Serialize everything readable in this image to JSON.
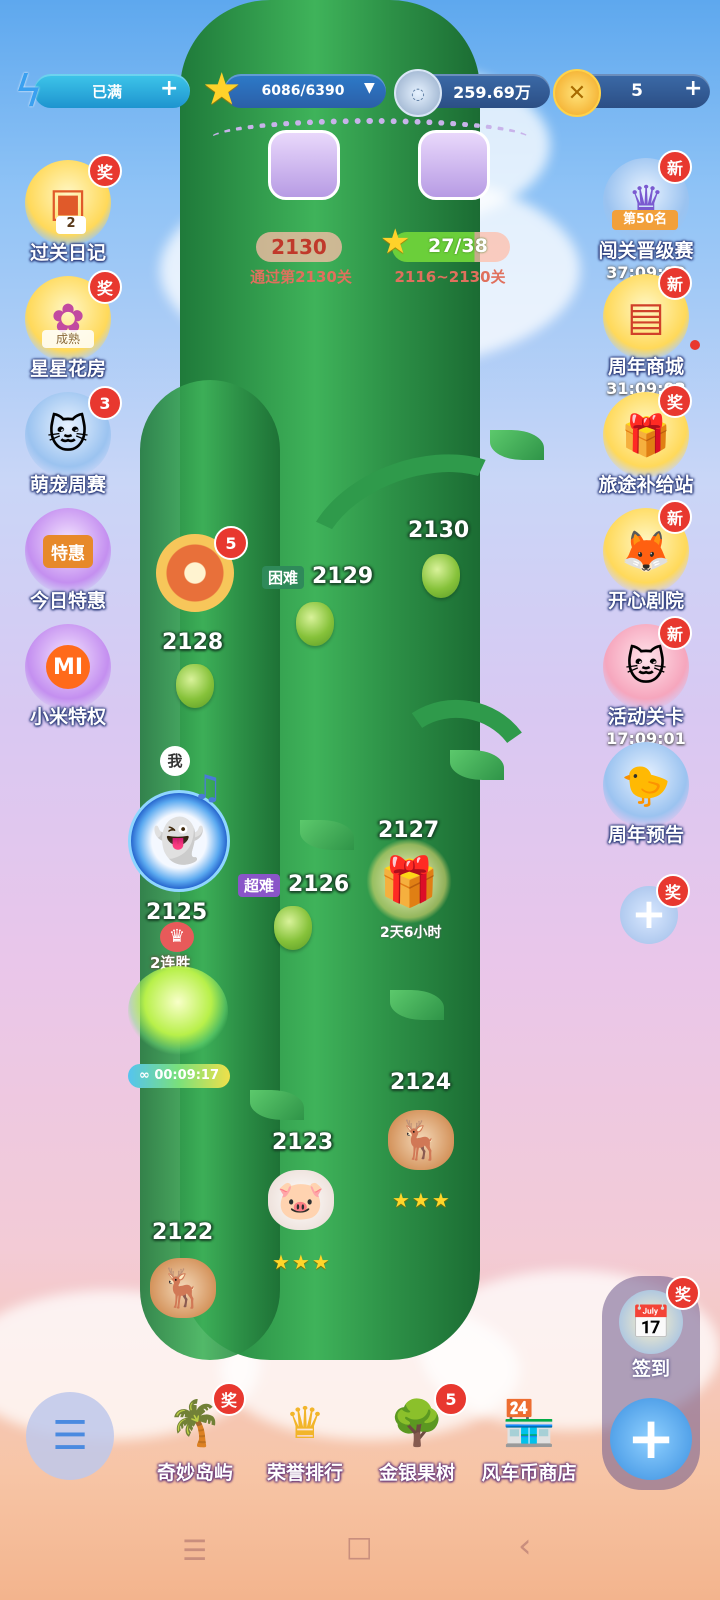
{
  "resources": {
    "energy": {
      "icon": "lightning-icon",
      "value": "已满"
    },
    "stars": {
      "icon": "star-icon",
      "value": "6086/6390"
    },
    "coins": {
      "icon": "silver-coin-icon",
      "value": "259.69万"
    },
    "gold": {
      "icon": "gold-coin-icon",
      "value": "5"
    }
  },
  "lock_section": {
    "left_value": "2130",
    "left_caption": "通过第2130关",
    "right_value": "27/38",
    "right_caption": "2116~2130关"
  },
  "left_menu": [
    {
      "label": "过关日记",
      "badge": "奖",
      "sub": "2"
    },
    {
      "label": "星星花房",
      "badge": "奖",
      "sub": "成熟"
    },
    {
      "label": "萌宠周赛",
      "badge": "3"
    },
    {
      "label": "今日特惠",
      "inner": "特惠"
    },
    {
      "label": "小米特权",
      "inner": "MI"
    }
  ],
  "right_menu": [
    {
      "label": "闯关晋级赛",
      "badge": "新",
      "inner": "第50名",
      "timer": "37:09:02"
    },
    {
      "label": "周年商城",
      "badge": "新",
      "timer": "31:09:02"
    },
    {
      "label": "旅途补给站",
      "badge": "奖"
    },
    {
      "label": "开心剧院",
      "badge": "新"
    },
    {
      "label": "活动关卡",
      "badge": "新",
      "timer": "17:09:01"
    },
    {
      "label": "周年预告"
    },
    {
      "badge": "奖"
    }
  ],
  "levels": {
    "l2130": "2130",
    "l2129": "2129",
    "l2129_tag": "困难",
    "l2128": "2128",
    "l2128_badge": "5",
    "me_tag": "我",
    "l2127": "2127",
    "l2127_timer": "2天6小时",
    "l2126": "2126",
    "l2126_tag": "超难",
    "l2125": "2125",
    "l2125_streak": "2连胜",
    "l2125_timer": "00:09:17",
    "l2124": "2124",
    "l2123": "2123",
    "l2122": "2122",
    "star_marks": "★★★"
  },
  "side_right_bottom": {
    "signin_label": "签到",
    "signin_badge": "奖"
  },
  "bottom_nav": [
    {
      "label": "奇妙岛屿",
      "badge": "奖"
    },
    {
      "label": "荣誉排行"
    },
    {
      "label": "金银果树",
      "badge": "5"
    },
    {
      "label": "风车币商店"
    }
  ],
  "system_nav": {
    "menu": "☰",
    "home": "□",
    "back": "‹"
  }
}
